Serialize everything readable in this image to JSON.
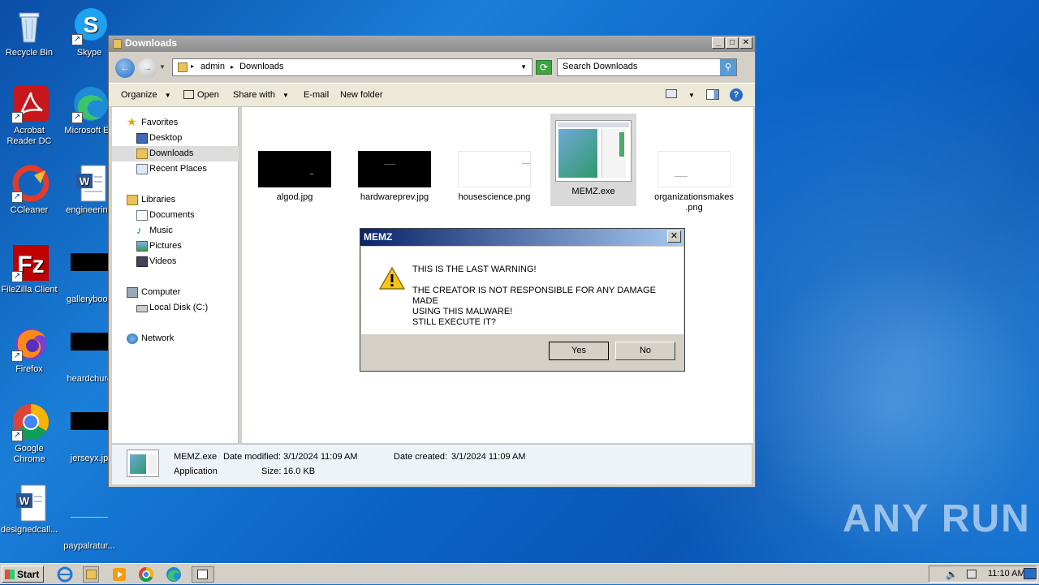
{
  "desktop": {
    "icons": [
      {
        "label": "Recycle Bin"
      },
      {
        "label": "Skype"
      },
      {
        "label": "Acrobat Reader DC"
      },
      {
        "label": "Microsoft Ed"
      },
      {
        "label": "CCleaner"
      },
      {
        "label": "engineering"
      },
      {
        "label": "FileZilla Client"
      },
      {
        "label": "gallerybook"
      },
      {
        "label": "Firefox"
      },
      {
        "label": "heardchurc"
      },
      {
        "label": "Google Chrome"
      },
      {
        "label": "jerseyx.jp"
      },
      {
        "label": "designedcall..."
      },
      {
        "label": "paypalratur..."
      }
    ],
    "watermark": "ANY RUN"
  },
  "explorer": {
    "title": "Downloads",
    "breadcrumb": [
      "admin",
      "Downloads"
    ],
    "search_placeholder": "Search Downloads",
    "toolbar": {
      "organize": "Organize",
      "open": "Open",
      "share_with": "Share with",
      "email": "E-mail",
      "new_folder": "New folder"
    },
    "nav": {
      "favorites": "Favorites",
      "desktop": "Desktop",
      "downloads": "Downloads",
      "recent_places": "Recent Places",
      "libraries": "Libraries",
      "documents": "Documents",
      "music": "Music",
      "pictures": "Pictures",
      "videos": "Videos",
      "computer": "Computer",
      "local_disk": "Local Disk (C:)",
      "network": "Network"
    },
    "files": [
      {
        "name": "algod.jpg"
      },
      {
        "name": "hardwareprev.jpg"
      },
      {
        "name": "housescience.png"
      },
      {
        "name": "MEMZ.exe"
      },
      {
        "name": "organizationsmakes\n.png"
      }
    ],
    "details": {
      "name": "MEMZ.exe",
      "type": "Application",
      "date_modified_label": "Date modified:",
      "date_modified": "3/1/2024 11:09 AM",
      "size_label": "Size:",
      "size": "16.0 KB",
      "date_created_label": "Date created:",
      "date_created": "3/1/2024 11:09 AM"
    }
  },
  "dialog": {
    "title": "MEMZ",
    "line1": "THIS IS THE LAST WARNING!",
    "line2": "THE CREATOR IS NOT RESPONSIBLE FOR ANY DAMAGE MADE",
    "line3": "USING THIS MALWARE!",
    "line4": "STILL EXECUTE IT?",
    "yes": "Yes",
    "no": "No"
  },
  "taskbar": {
    "start": "Start",
    "clock": "11:10 AM"
  }
}
